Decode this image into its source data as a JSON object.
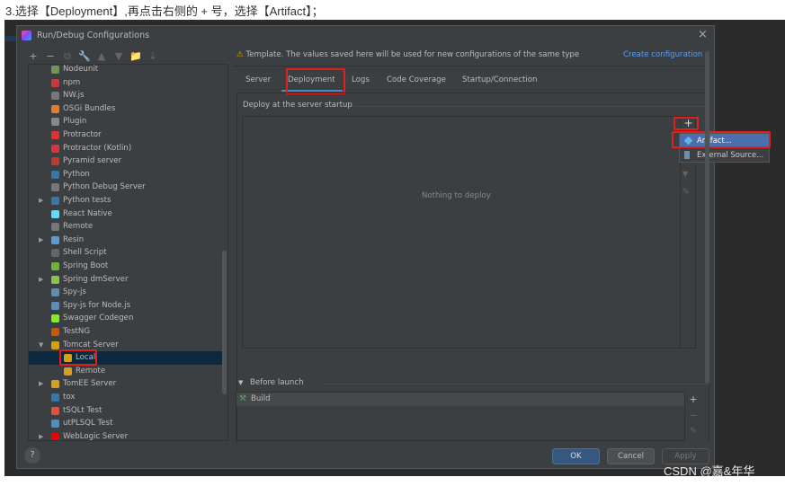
{
  "caption": "3.选择【Deployment】,再点击右侧的 + 号，选择【Artifact】；",
  "dialog": {
    "title": "Run/Debug Configurations",
    "close": "×"
  },
  "toolbar": [
    "+",
    "−",
    "⧉",
    "🔧",
    "▲",
    "▼",
    "📁",
    "↓"
  ],
  "tree": [
    {
      "label": "Nodeunit",
      "color": "#6a9955",
      "arrow": ""
    },
    {
      "label": "npm",
      "color": "#cb3837",
      "arrow": ""
    },
    {
      "label": "NW.js",
      "color": "#777",
      "arrow": ""
    },
    {
      "label": "OSGi Bundles",
      "color": "#e8782a",
      "arrow": ""
    },
    {
      "label": "Plugin",
      "color": "#888",
      "arrow": ""
    },
    {
      "label": "Protractor",
      "color": "#e23237",
      "arrow": ""
    },
    {
      "label": "Protractor (Kotlin)",
      "color": "#e23237",
      "arrow": ""
    },
    {
      "label": "Pyramid server",
      "color": "#c0392b",
      "arrow": ""
    },
    {
      "label": "Python",
      "color": "#3776ab",
      "arrow": ""
    },
    {
      "label": "Python Debug Server",
      "color": "#777",
      "arrow": ""
    },
    {
      "label": "Python tests",
      "color": "#3776ab",
      "arrow": "▶"
    },
    {
      "label": "React Native",
      "color": "#61dafb",
      "arrow": ""
    },
    {
      "label": "Remote",
      "color": "#777",
      "arrow": ""
    },
    {
      "label": "Resin",
      "color": "#5b9bd5",
      "arrow": "▶"
    },
    {
      "label": "Shell Script",
      "color": "#666",
      "arrow": ""
    },
    {
      "label": "Spring Boot",
      "color": "#6db33f",
      "arrow": ""
    },
    {
      "label": "Spring dmServer",
      "color": "#8bc34a",
      "arrow": "▶"
    },
    {
      "label": "Spy-js",
      "color": "#5b8db8",
      "arrow": ""
    },
    {
      "label": "Spy-js for Node.js",
      "color": "#5b8db8",
      "arrow": ""
    },
    {
      "label": "Swagger Codegen",
      "color": "#85ea2d",
      "arrow": ""
    },
    {
      "label": "TestNG",
      "color": "#d35400",
      "arrow": ""
    },
    {
      "label": "Tomcat Server",
      "color": "#d4a017",
      "arrow": "▼"
    },
    {
      "label": "Local",
      "color": "#d4a017",
      "arrow": "",
      "child": true,
      "selected": true
    },
    {
      "label": "Remote",
      "color": "#d4a017",
      "arrow": "",
      "child": true
    },
    {
      "label": "TomEE Server",
      "color": "#d4a017",
      "arrow": "▶"
    },
    {
      "label": "tox",
      "color": "#3776ab",
      "arrow": ""
    },
    {
      "label": "tSQLt Test",
      "color": "#e74c3c",
      "arrow": ""
    },
    {
      "label": "utPLSQL Test",
      "color": "#4a90c2",
      "arrow": ""
    },
    {
      "label": "WebLogic Server",
      "color": "#e00",
      "arrow": "▶"
    }
  ],
  "warning": {
    "icon": "⚠",
    "text": "Template. The values saved here will be used for new configurations of the same type",
    "link": "Create configuration"
  },
  "tabs": [
    "Server",
    "Deployment",
    "Logs",
    "Code Coverage",
    "Startup/Connection"
  ],
  "active_tab": "Deployment",
  "deploy": {
    "label": "Deploy at the server startup",
    "empty": "Nothing to deploy",
    "add": "+"
  },
  "popup": {
    "items": [
      "Artifact...",
      "External Source..."
    ],
    "selected": "Artifact..."
  },
  "before_launch": {
    "label": "Before launch",
    "items": [
      "Build"
    ],
    "add": "+",
    "remove": "−",
    "edit": "✎"
  },
  "buttons": {
    "help": "?",
    "ok": "OK",
    "cancel": "Cancel",
    "apply": "Apply"
  },
  "watermark": "CSDN @嘉&年华",
  "colors": {
    "accent": "#4a88c7",
    "highlight": "#e0201a",
    "selection": "#4b6eaf",
    "dialog_bg": "#3c3f41"
  }
}
